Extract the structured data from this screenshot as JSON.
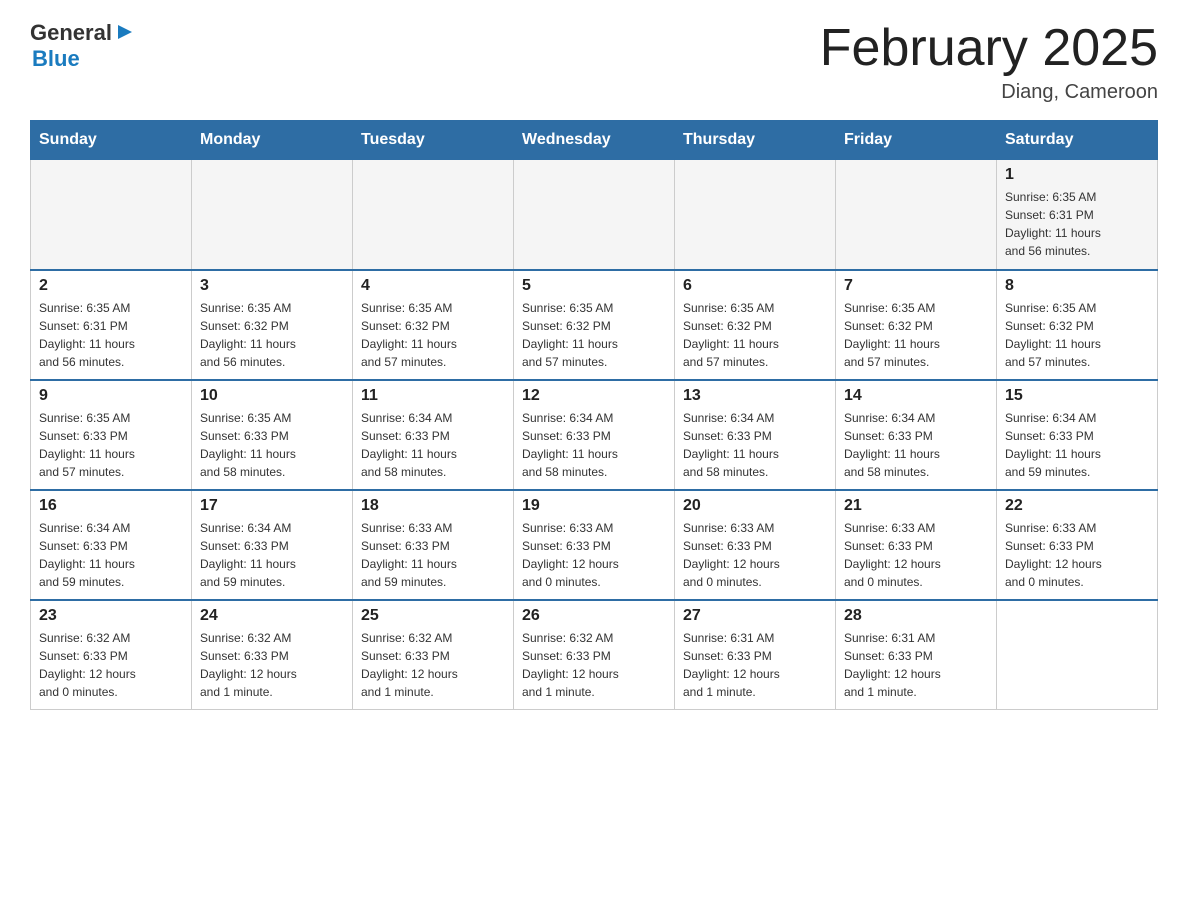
{
  "logo": {
    "text_general": "General",
    "text_blue": "Blue",
    "arrow_symbol": "▶"
  },
  "header": {
    "title": "February 2025",
    "subtitle": "Diang, Cameroon"
  },
  "days_of_week": [
    "Sunday",
    "Monday",
    "Tuesday",
    "Wednesday",
    "Thursday",
    "Friday",
    "Saturday"
  ],
  "weeks": [
    {
      "cells": [
        {
          "day": "",
          "info": ""
        },
        {
          "day": "",
          "info": ""
        },
        {
          "day": "",
          "info": ""
        },
        {
          "day": "",
          "info": ""
        },
        {
          "day": "",
          "info": ""
        },
        {
          "day": "",
          "info": ""
        },
        {
          "day": "1",
          "info": "Sunrise: 6:35 AM\nSunset: 6:31 PM\nDaylight: 11 hours\nand 56 minutes."
        }
      ]
    },
    {
      "cells": [
        {
          "day": "2",
          "info": "Sunrise: 6:35 AM\nSunset: 6:31 PM\nDaylight: 11 hours\nand 56 minutes."
        },
        {
          "day": "3",
          "info": "Sunrise: 6:35 AM\nSunset: 6:32 PM\nDaylight: 11 hours\nand 56 minutes."
        },
        {
          "day": "4",
          "info": "Sunrise: 6:35 AM\nSunset: 6:32 PM\nDaylight: 11 hours\nand 57 minutes."
        },
        {
          "day": "5",
          "info": "Sunrise: 6:35 AM\nSunset: 6:32 PM\nDaylight: 11 hours\nand 57 minutes."
        },
        {
          "day": "6",
          "info": "Sunrise: 6:35 AM\nSunset: 6:32 PM\nDaylight: 11 hours\nand 57 minutes."
        },
        {
          "day": "7",
          "info": "Sunrise: 6:35 AM\nSunset: 6:32 PM\nDaylight: 11 hours\nand 57 minutes."
        },
        {
          "day": "8",
          "info": "Sunrise: 6:35 AM\nSunset: 6:32 PM\nDaylight: 11 hours\nand 57 minutes."
        }
      ]
    },
    {
      "cells": [
        {
          "day": "9",
          "info": "Sunrise: 6:35 AM\nSunset: 6:33 PM\nDaylight: 11 hours\nand 57 minutes."
        },
        {
          "day": "10",
          "info": "Sunrise: 6:35 AM\nSunset: 6:33 PM\nDaylight: 11 hours\nand 58 minutes."
        },
        {
          "day": "11",
          "info": "Sunrise: 6:34 AM\nSunset: 6:33 PM\nDaylight: 11 hours\nand 58 minutes."
        },
        {
          "day": "12",
          "info": "Sunrise: 6:34 AM\nSunset: 6:33 PM\nDaylight: 11 hours\nand 58 minutes."
        },
        {
          "day": "13",
          "info": "Sunrise: 6:34 AM\nSunset: 6:33 PM\nDaylight: 11 hours\nand 58 minutes."
        },
        {
          "day": "14",
          "info": "Sunrise: 6:34 AM\nSunset: 6:33 PM\nDaylight: 11 hours\nand 58 minutes."
        },
        {
          "day": "15",
          "info": "Sunrise: 6:34 AM\nSunset: 6:33 PM\nDaylight: 11 hours\nand 59 minutes."
        }
      ]
    },
    {
      "cells": [
        {
          "day": "16",
          "info": "Sunrise: 6:34 AM\nSunset: 6:33 PM\nDaylight: 11 hours\nand 59 minutes."
        },
        {
          "day": "17",
          "info": "Sunrise: 6:34 AM\nSunset: 6:33 PM\nDaylight: 11 hours\nand 59 minutes."
        },
        {
          "day": "18",
          "info": "Sunrise: 6:33 AM\nSunset: 6:33 PM\nDaylight: 11 hours\nand 59 minutes."
        },
        {
          "day": "19",
          "info": "Sunrise: 6:33 AM\nSunset: 6:33 PM\nDaylight: 12 hours\nand 0 minutes."
        },
        {
          "day": "20",
          "info": "Sunrise: 6:33 AM\nSunset: 6:33 PM\nDaylight: 12 hours\nand 0 minutes."
        },
        {
          "day": "21",
          "info": "Sunrise: 6:33 AM\nSunset: 6:33 PM\nDaylight: 12 hours\nand 0 minutes."
        },
        {
          "day": "22",
          "info": "Sunrise: 6:33 AM\nSunset: 6:33 PM\nDaylight: 12 hours\nand 0 minutes."
        }
      ]
    },
    {
      "cells": [
        {
          "day": "23",
          "info": "Sunrise: 6:32 AM\nSunset: 6:33 PM\nDaylight: 12 hours\nand 0 minutes."
        },
        {
          "day": "24",
          "info": "Sunrise: 6:32 AM\nSunset: 6:33 PM\nDaylight: 12 hours\nand 1 minute."
        },
        {
          "day": "25",
          "info": "Sunrise: 6:32 AM\nSunset: 6:33 PM\nDaylight: 12 hours\nand 1 minute."
        },
        {
          "day": "26",
          "info": "Sunrise: 6:32 AM\nSunset: 6:33 PM\nDaylight: 12 hours\nand 1 minute."
        },
        {
          "day": "27",
          "info": "Sunrise: 6:31 AM\nSunset: 6:33 PM\nDaylight: 12 hours\nand 1 minute."
        },
        {
          "day": "28",
          "info": "Sunrise: 6:31 AM\nSunset: 6:33 PM\nDaylight: 12 hours\nand 1 minute."
        },
        {
          "day": "",
          "info": ""
        }
      ]
    }
  ]
}
